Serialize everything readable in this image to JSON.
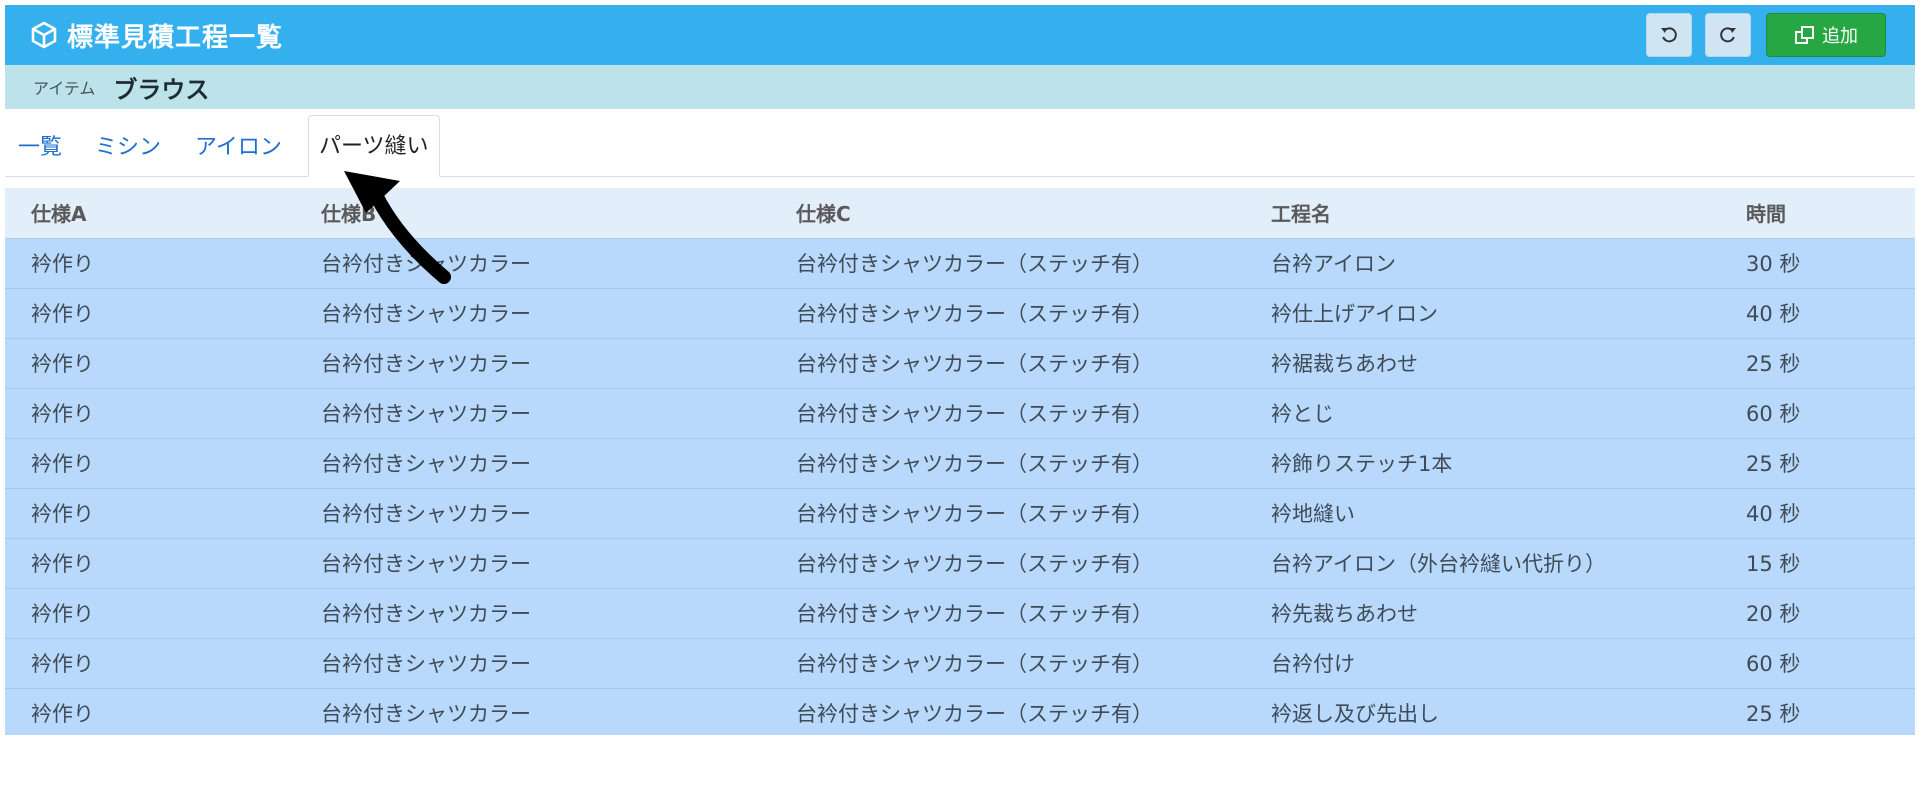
{
  "header": {
    "title": "標準見積工程一覧",
    "icon": "cube-icon",
    "undo_icon": "undo-icon",
    "redo_icon": "redo-icon",
    "add_label": "追加",
    "add_icon": "add-window-icon",
    "colors": {
      "header_bg": "#35b0ef",
      "add_bg": "#27a744",
      "item_bar_bg": "#bde3ea"
    }
  },
  "item": {
    "label": "アイテム",
    "value": "ブラウス"
  },
  "tabs": [
    {
      "label": "一覧",
      "active": false
    },
    {
      "label": "ミシン",
      "active": false
    },
    {
      "label": "アイロン",
      "active": false
    },
    {
      "label": "パーツ縫い",
      "active": true
    }
  ],
  "table": {
    "columns": [
      "仕様A",
      "仕様B",
      "仕様C",
      "工程名",
      "時間"
    ],
    "rows": [
      [
        "衿作り",
        "台衿付きシャツカラー",
        "台衿付きシャツカラー（ステッチ有）",
        "台衿アイロン",
        "30 秒"
      ],
      [
        "衿作り",
        "台衿付きシャツカラー",
        "台衿付きシャツカラー（ステッチ有）",
        "衿仕上げアイロン",
        "40 秒"
      ],
      [
        "衿作り",
        "台衿付きシャツカラー",
        "台衿付きシャツカラー（ステッチ有）",
        "衿裾裁ちあわせ",
        "25 秒"
      ],
      [
        "衿作り",
        "台衿付きシャツカラー",
        "台衿付きシャツカラー（ステッチ有）",
        "衿とじ",
        "60 秒"
      ],
      [
        "衿作り",
        "台衿付きシャツカラー",
        "台衿付きシャツカラー（ステッチ有）",
        "衿飾りステッチ1本",
        "25 秒"
      ],
      [
        "衿作り",
        "台衿付きシャツカラー",
        "台衿付きシャツカラー（ステッチ有）",
        "衿地縫い",
        "40 秒"
      ],
      [
        "衿作り",
        "台衿付きシャツカラー",
        "台衿付きシャツカラー（ステッチ有）",
        "台衿アイロン（外台衿縫い代折り）",
        "15 秒"
      ],
      [
        "衿作り",
        "台衿付きシャツカラー",
        "台衿付きシャツカラー（ステッチ有）",
        "衿先裁ちあわせ",
        "20 秒"
      ],
      [
        "衿作り",
        "台衿付きシャツカラー",
        "台衿付きシャツカラー（ステッチ有）",
        "台衿付け",
        "60 秒"
      ],
      [
        "衿作り",
        "台衿付きシャツカラー",
        "台衿付きシャツカラー（ステッチ有）",
        "衿返し及び先出し",
        "25 秒"
      ]
    ]
  }
}
